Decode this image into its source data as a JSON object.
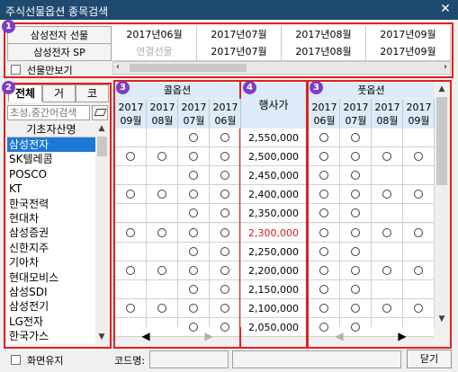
{
  "window": {
    "title": "주식선물옵션 종목검색",
    "close_glyph": "✕"
  },
  "futures": {
    "rows": [
      {
        "label": "삼성전자 선물",
        "cells": [
          "2017년06월",
          "2017년07월",
          "2017년08월",
          "2017년09월"
        ]
      },
      {
        "label": "삼성전자 SP",
        "cells": [
          "연결선물",
          "2017년07월",
          "2017년08월",
          "2017년09월"
        ]
      }
    ],
    "futures_only_label": "선물만보기"
  },
  "left_panel": {
    "tabs": [
      "전체",
      "거",
      "코"
    ],
    "search_placeholder": "초성,중간어검색",
    "list_header": "기초자산명",
    "items": [
      "삼성전자",
      "SK텔레콤",
      "POSCO",
      "KT",
      "한국전력",
      "현대차",
      "삼성증권",
      "신한지주",
      "기아차",
      "현대모비스",
      "삼성SDI",
      "삼성전기",
      "LG전자",
      "한국가스"
    ],
    "selected_index": 0
  },
  "options": {
    "call_label": "콜옵션",
    "put_label": "풋옵션",
    "strike_label": "행사가",
    "call_months": [
      [
        "2017",
        "09월"
      ],
      [
        "2017",
        "08월"
      ],
      [
        "2017",
        "07월"
      ],
      [
        "2017",
        "06월"
      ]
    ],
    "put_months": [
      [
        "2017",
        "06월"
      ],
      [
        "2017",
        "07월"
      ],
      [
        "2017",
        "08월"
      ],
      [
        "2017",
        "09월"
      ]
    ],
    "strikes": [
      "2,550,000",
      "2,500,000",
      "2,450,000",
      "2,400,000",
      "2,350,000",
      "2,300,000",
      "2,250,000",
      "2,200,000",
      "2,150,000",
      "2,100,000",
      "2,050,000"
    ],
    "atm_strike": "2,300,000",
    "call_marks": [
      [
        0,
        0,
        1,
        1
      ],
      [
        1,
        1,
        1,
        1
      ],
      [
        0,
        0,
        1,
        1
      ],
      [
        1,
        1,
        1,
        1
      ],
      [
        0,
        0,
        1,
        1
      ],
      [
        1,
        1,
        1,
        1
      ],
      [
        0,
        0,
        1,
        1
      ],
      [
        1,
        1,
        1,
        1
      ],
      [
        0,
        0,
        1,
        1
      ],
      [
        1,
        1,
        1,
        1
      ],
      [
        0,
        0,
        1,
        1
      ]
    ],
    "put_marks": [
      [
        1,
        1,
        0,
        0
      ],
      [
        1,
        1,
        1,
        1
      ],
      [
        1,
        1,
        0,
        0
      ],
      [
        1,
        1,
        1,
        1
      ],
      [
        1,
        1,
        0,
        0
      ],
      [
        1,
        1,
        1,
        1
      ],
      [
        1,
        1,
        0,
        0
      ],
      [
        1,
        1,
        1,
        1
      ],
      [
        1,
        1,
        0,
        0
      ],
      [
        1,
        1,
        1,
        1
      ],
      [
        1,
        1,
        0,
        0
      ]
    ]
  },
  "badges": [
    "1",
    "2",
    "3",
    "4",
    "3"
  ],
  "bottom": {
    "keep_screen_label": "화면유지",
    "code_label": "코드명:",
    "close_button": "닫기"
  }
}
